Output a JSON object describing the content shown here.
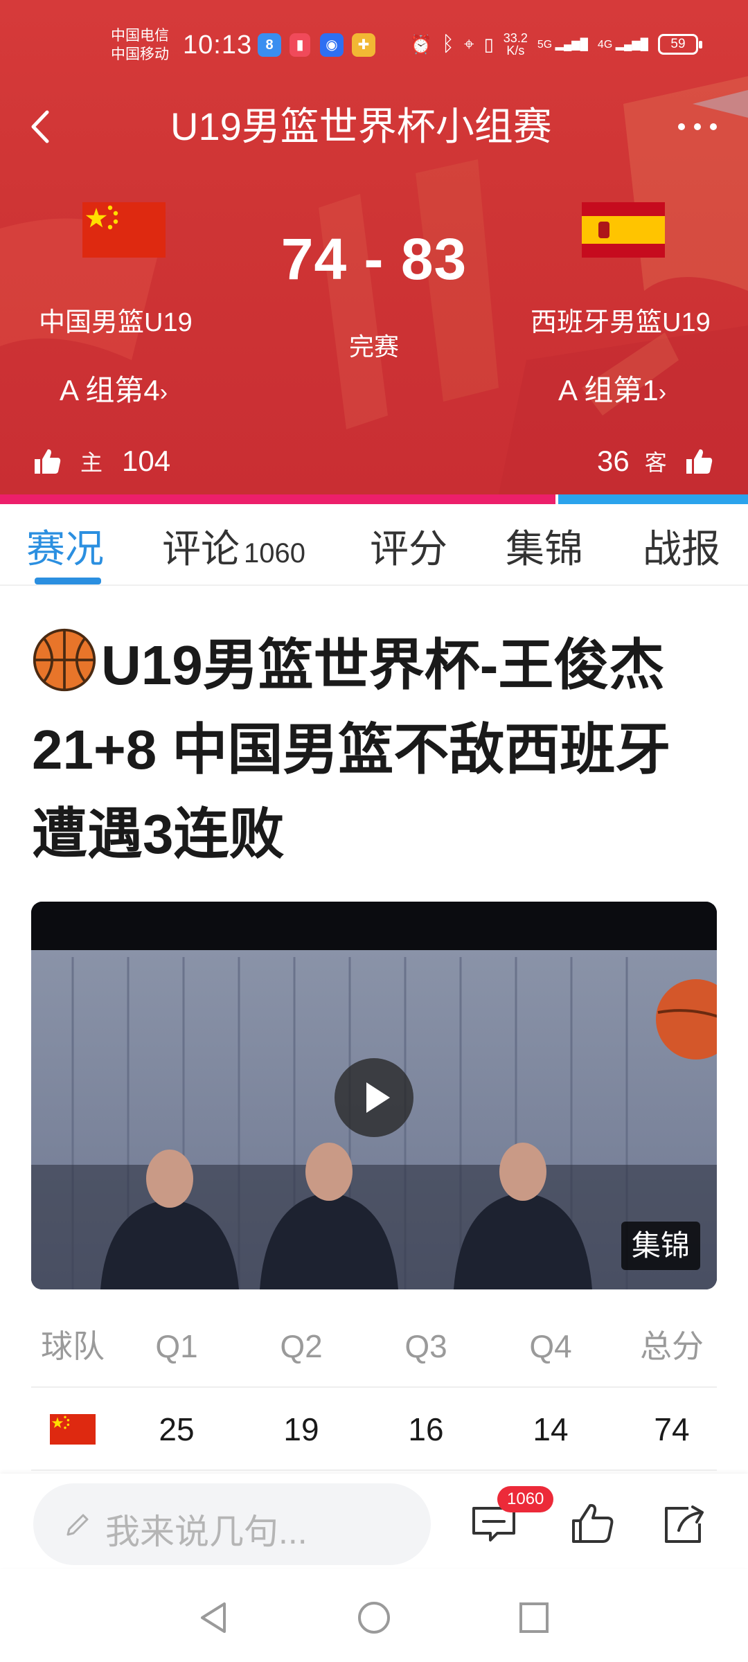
{
  "status_bar": {
    "carrier_1": "中国电信",
    "carrier_2": "中国移动",
    "time": "10:13",
    "net_speed_value": "33.2",
    "net_speed_unit": "K/s",
    "signal_1": "5G",
    "signal_2": "4G",
    "battery": "59"
  },
  "nav": {
    "title": "U19男篮世界杯小组赛"
  },
  "match": {
    "score": "74 - 83",
    "status": "完赛",
    "home": {
      "name": "中国男篮U19",
      "rank": "A 组第4",
      "vote_label": "主",
      "votes": "104"
    },
    "away": {
      "name": "西班牙男篮U19",
      "rank": "A 组第1",
      "vote_label": "客",
      "votes": "36"
    },
    "support_share_home": 0.743
  },
  "tabs": [
    {
      "label": "赛况",
      "count": ""
    },
    {
      "label": "评论",
      "count": "1060"
    },
    {
      "label": "评分",
      "count": ""
    },
    {
      "label": "集锦",
      "count": ""
    },
    {
      "label": "战报",
      "count": ""
    }
  ],
  "article": {
    "headline": "U19男篮世界杯-王俊杰21+8 中国男篮不敌西班牙遭遇3连败",
    "video_tag": "集锦"
  },
  "quarter_table": {
    "headers": [
      "球队",
      "Q1",
      "Q2",
      "Q3",
      "Q4",
      "总分"
    ],
    "rows": [
      {
        "team_flag": "china-flag-icon",
        "q1": "25",
        "q2": "19",
        "q3": "16",
        "q4": "14",
        "total": "74"
      }
    ]
  },
  "bottom_bar": {
    "input_placeholder": "我来说几句...",
    "comment_badge": "1060"
  },
  "colors": {
    "header_red": "#cf3535",
    "accent_blue": "#2b8fe0",
    "home_bar": "#ec1f6a",
    "away_bar": "#2ba3ec"
  }
}
